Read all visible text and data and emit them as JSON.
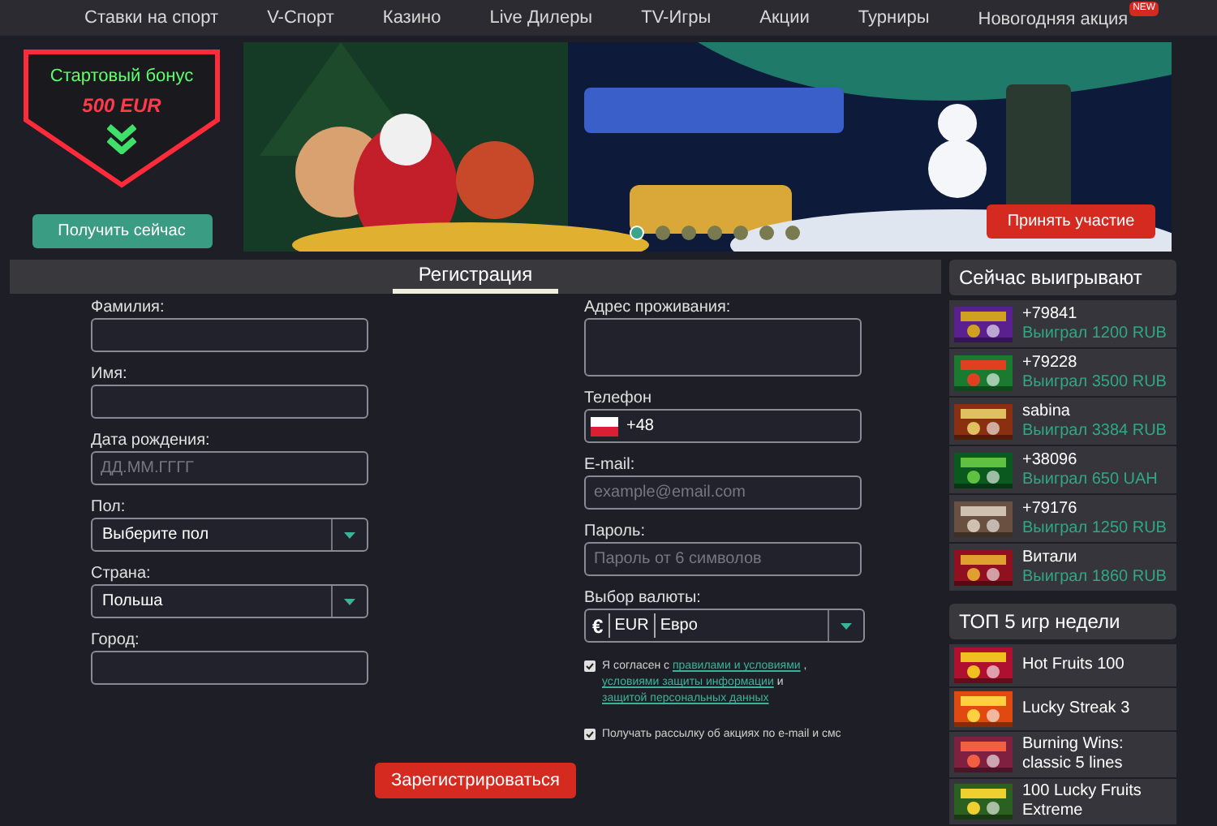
{
  "nav": [
    {
      "label": "Ставки на спорт"
    },
    {
      "label": "V-Спорт"
    },
    {
      "label": "Казино"
    },
    {
      "label": "Live Дилеры"
    },
    {
      "label": "TV-Игры"
    },
    {
      "label": "Акции"
    },
    {
      "label": "Турниры"
    },
    {
      "label": "Новогодняя акция",
      "badge": "NEW"
    }
  ],
  "promo": {
    "title": "Стартовый бонус",
    "amount": "500 EUR",
    "button": "Получить сейчас"
  },
  "banner": {
    "button": "Принять участие",
    "dots": [
      {
        "selected": true
      },
      {
        "selected": false
      },
      {
        "selected": false
      },
      {
        "selected": false
      },
      {
        "selected": false
      },
      {
        "selected": false
      },
      {
        "selected": false
      }
    ]
  },
  "registration": {
    "tab": {
      "label": "Регистрация",
      "selected": true
    },
    "left_fields": [
      {
        "label": "Фамилия:",
        "kind": "text"
      },
      {
        "label": "Имя:",
        "kind": "text"
      },
      {
        "label": "Дата рождения:",
        "kind": "text",
        "placeholder": "ДД.ММ.ГГГГ"
      },
      {
        "label": "Пол:",
        "kind": "select",
        "value": "Выберите пол"
      },
      {
        "label": "Страна:",
        "kind": "select",
        "value": "Польша"
      },
      {
        "label": "Город:",
        "kind": "text"
      }
    ],
    "right_fields": [
      {
        "label": "Адрес проживания:",
        "kind": "textarea"
      },
      {
        "label": "Телефон",
        "kind": "phone",
        "value": "+48"
      },
      {
        "label": "E-mail:",
        "kind": "text",
        "placeholder": "example@email.com"
      },
      {
        "label": "Пароль:",
        "kind": "text",
        "placeholder": "Пароль от 6 символов"
      },
      {
        "label": "Выбор валюты:",
        "kind": "currency",
        "symbol": "€",
        "code": "EUR",
        "value": "Евро"
      }
    ],
    "consents": [
      {
        "checked": true,
        "parts": [
          {
            "kind": "text",
            "text": "Я согласен с "
          },
          {
            "kind": "link",
            "text": "правилами и условиями"
          },
          {
            "kind": "text",
            "text": " , "
          },
          {
            "kind": "link",
            "text": "условиями защиты информации"
          },
          {
            "kind": "text",
            "text": " и "
          },
          {
            "kind": "link",
            "text": "защитой персональных данных"
          }
        ]
      },
      {
        "checked": true,
        "parts": [
          {
            "kind": "text",
            "text": "Получать рассылку об акциях по e-mail и смс"
          }
        ]
      }
    ],
    "submit": "Зарегистрироваться"
  },
  "winners": {
    "title": "Сейчас выигрывают",
    "items": [
      {
        "player": "+79841",
        "win": "Выиграл 1200 RUB"
      },
      {
        "player": "+79228",
        "win": "Выиграл 3500 RUB"
      },
      {
        "player": "sabina",
        "win": "Выиграл 3384 RUB"
      },
      {
        "player": "+38096",
        "win": "Выиграл 650 UAH"
      },
      {
        "player": "+79176",
        "win": "Выиграл 1250 RUB"
      },
      {
        "player": "Витали",
        "win": "Выиграл 1860 RUB"
      }
    ]
  },
  "top_games": {
    "title": "ТОП 5 игр недели",
    "items": [
      {
        "name": "Hot Fruits 100"
      },
      {
        "name": "Lucky Streak 3"
      },
      {
        "name": "Burning Wins: classic 5 lines"
      },
      {
        "name": "100 Lucky Fruits Extreme"
      }
    ]
  }
}
